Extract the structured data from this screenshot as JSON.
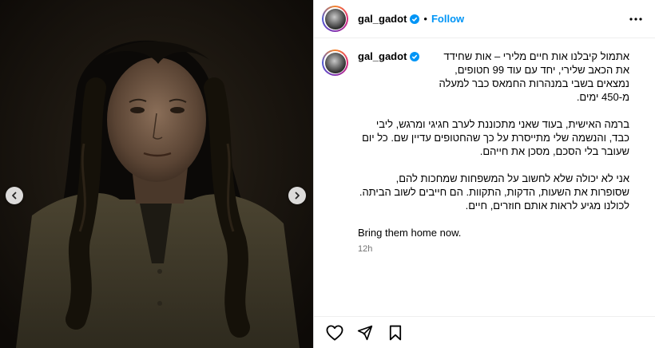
{
  "post": {
    "username": "gal_gadot",
    "follow_label": "Follow",
    "separator": "•",
    "caption_paragraphs": [
      "אתמול קיבלנו אות חיים מלירי – אות שחידד את הכאב שלירי, יחד עם עוד 99 חטופים, נמצאים בשבי במנהרות החמאס כבר למעלה מ-450 ימים.",
      "ברמה האישית, בעוד שאני מתכוננת לערב חגיגי ומרגש, ליבי כבד, והנשמה שלי מתייסרת על כך שהחטופים עדיין שם. כל יום שעובר בלי הסכם, מסכן את חייהם.",
      "אני לא יכולה שלא לחשוב על המשפחות שמחכות להם, שסופרות את השעות, הדקות, התקוות. הם חייבים לשוב הביתה. לכולנו מגיע לראות אותם חוזרים, חיים."
    ],
    "caption_english": "Bring them home now.",
    "timestamp": "12h"
  },
  "icons": {
    "verified": "verified-badge-icon",
    "more": "more-options-icon",
    "prev": "chevron-left-icon",
    "next": "chevron-right-icon",
    "like": "heart-icon",
    "share": "paper-plane-icon",
    "save": "bookmark-icon"
  },
  "colors": {
    "link_blue": "#0095f6",
    "verified_blue": "#0095f6",
    "muted": "#737373"
  }
}
